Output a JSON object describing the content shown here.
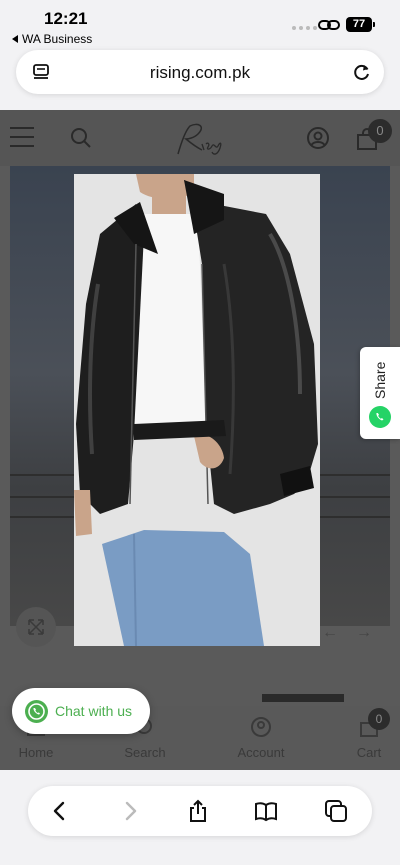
{
  "status_bar": {
    "time": "12:21",
    "back_app": "WA Business",
    "battery": "77"
  },
  "address_bar": {
    "url": "rising.com.pk"
  },
  "site_header": {
    "brand": "Rising",
    "cart_count": "0"
  },
  "share_tab": {
    "label": "Share"
  },
  "chat_widget": {
    "label": "Chat with us",
    "accent_color": "#4caf50"
  },
  "bottom_nav": {
    "items": [
      {
        "label": "Home",
        "icon": "home-icon"
      },
      {
        "label": "Search",
        "icon": "search-icon"
      },
      {
        "label": "Account",
        "icon": "account-icon"
      },
      {
        "label": "Cart",
        "icon": "cart-icon"
      }
    ],
    "cart_count": "0"
  },
  "safari_toolbar": {
    "icons": [
      "back-icon",
      "forward-icon",
      "share-icon",
      "bookmarks-icon",
      "tabs-icon"
    ]
  },
  "product": {
    "image_alt": "Black leather bomber jacket"
  }
}
